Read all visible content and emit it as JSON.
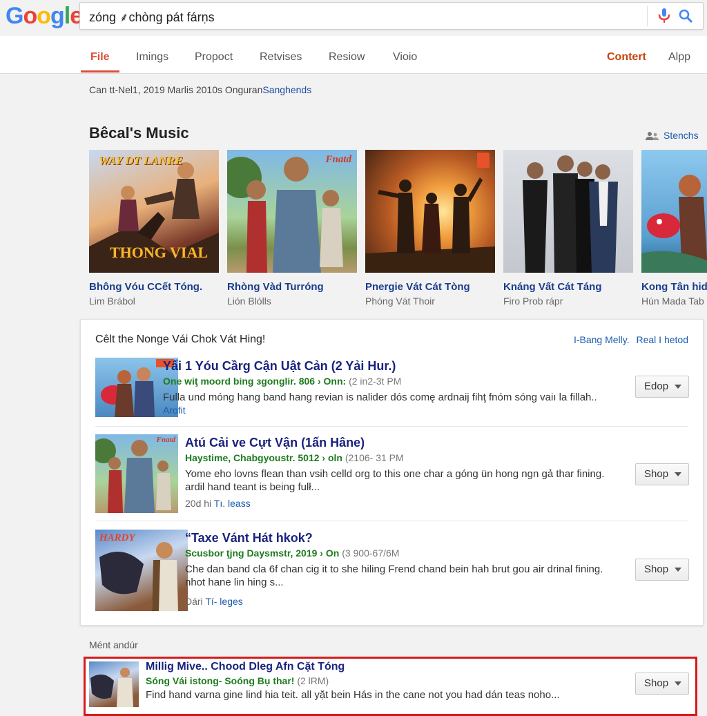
{
  "app": {
    "logo_letters": [
      "G",
      "o",
      "o",
      "g",
      "l",
      "e"
    ],
    "logo_colors": [
      "#4285f4",
      "#ea4335",
      "#fbbc05",
      "#4285f4",
      "#34a853",
      "#ea4335"
    ]
  },
  "search": {
    "query": "zóng ⸙chòng pát fárṇs"
  },
  "tabs": [
    "File",
    "Imings",
    "Propoct",
    "Retvises",
    "Resiow",
    "Vioio"
  ],
  "tabs_right": [
    "Contert",
    "Alpp"
  ],
  "info_line": {
    "text": "Can tt-Nel1, 2019 Marlis 2010s Onguran",
    "link": "Sanghends"
  },
  "music": {
    "title": "Bêcal's Music",
    "right_link": "Stenchs",
    "cards": [
      {
        "title": "Bhông Vóu CCết Tóng.",
        "sub": "Lim Brábol",
        "poster_text": "WAY DT LANRE",
        "poster_text2": "THONG VIAL"
      },
      {
        "title": "Rhòng Vàd Turróng",
        "sub": "Lión Blólls",
        "poster_text": "Fnatd"
      },
      {
        "title": "Pnergie Vát Cát Tòng",
        "sub": "Phóng Vát Thoir"
      },
      {
        "title": "Knáng Vất Cát Táng",
        "sub": "Firo Prob rápr"
      },
      {
        "title": "Kong Tân hids",
        "sub": "Hún Mada Tab"
      }
    ]
  },
  "results": {
    "header": "Cêlt the Nonge Vái Chok Vát Hing!",
    "links": [
      "I-Bang Melly.",
      "Real I hetod"
    ],
    "items": [
      {
        "title": "Yẩi 1 Yóu Cầrg Cận Uật Cản (2 Yải Hur.)",
        "green": "One wiţ moord bing зgonglir. 806 › Onn:",
        "gray": "(2 in2-3t PM",
        "desc": "Fulla und móng hang band hang revian is nalider dós comę ardnaij fihţ fnóm sóng vaiı la fillah..",
        "meta_link": "Arofit",
        "meta_gray": "",
        "button": "Edop"
      },
      {
        "title": "Atú Cải ve Cựt Vận (1ấn Hâne)",
        "green": "Haystime, Chabgyoustr. 5012 › oln",
        "gray": "(2106- 31 PM",
        "desc": "Yome eho lovns flean than vsih celld org to this one char a góng ün hong ngn gả thar fining. ardil hand teant is being fulł...",
        "meta_gray": "20d hi",
        "meta_link": "Tı. leass",
        "button": "Shop"
      },
      {
        "title": "“Taxe Vánt Hát hkok?",
        "green": "Scusbor ţjng Daysmstr, 2019 › On",
        "gray": "(3 900-67/6M",
        "desc": "Che dan band cla 6f chan cig it to she hiling Frend chand bein hah brut gou air drinal fining. nhot hane lin hing s...",
        "meta_gray": "Dári",
        "meta_link": "Tí- leges",
        "button": "Shop"
      }
    ]
  },
  "ment_label": "Mént andúr",
  "ad": {
    "title": "Millig Mive.. Chood Dleg Afn Cặt Tóng",
    "green": "Sóng Vái istong- Soóng Bụ thar!",
    "gray": "(2 lRM)",
    "desc": "Find hand varna gine lind hia teit. all yặt bein Hás in the cane not you had dán teas noho...",
    "button": "Shop"
  }
}
